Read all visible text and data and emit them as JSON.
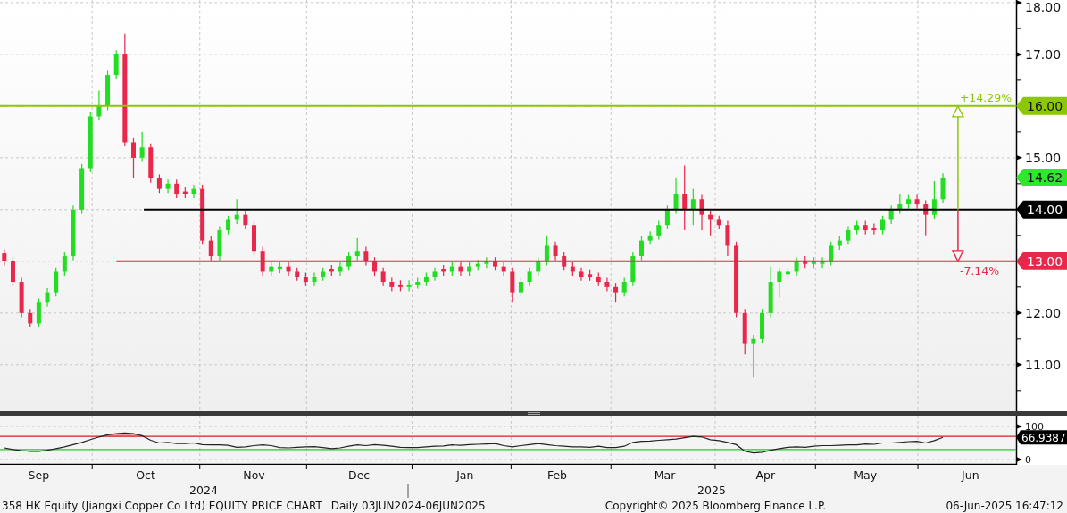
{
  "price_chart": {
    "chart_data": {
      "type": "candlestick",
      "categories": [
        null,
        null,
        null,
        null,
        null,
        null,
        null,
        null,
        null,
        null,
        null,
        null,
        null,
        null,
        null,
        null,
        null,
        null,
        null,
        null,
        null,
        null,
        null,
        null,
        null,
        null,
        null,
        null,
        null,
        null,
        null,
        null,
        null,
        null,
        null,
        null,
        null,
        null,
        null,
        null,
        null,
        null,
        null,
        null,
        null,
        null,
        null,
        null,
        null,
        null,
        null,
        null,
        null,
        null,
        null,
        null,
        null,
        null,
        null,
        null,
        null,
        null,
        null,
        null,
        null,
        null,
        null,
        null,
        null,
        null,
        null,
        null,
        null,
        null,
        null,
        null,
        null,
        null,
        null,
        null,
        null,
        null,
        null,
        null,
        null,
        null,
        null,
        null,
        null,
        null,
        null,
        null,
        null,
        null,
        null,
        null,
        null,
        null,
        null,
        null,
        null,
        null,
        null,
        null,
        null,
        null,
        null,
        null,
        null,
        null,
        null,
        null,
        null,
        null,
        null,
        null,
        null,
        null
      ],
      "ohlc": [
        [
          13.15,
          13.23,
          12.92,
          13.0
        ],
        [
          13.0,
          13.08,
          12.52,
          12.6
        ],
        [
          12.6,
          12.68,
          11.92,
          12.0
        ],
        [
          12.0,
          12.08,
          11.72,
          11.8
        ],
        [
          11.8,
          12.28,
          11.72,
          12.2
        ],
        [
          12.2,
          12.48,
          12.12,
          12.4
        ],
        [
          12.4,
          12.88,
          12.32,
          12.8
        ],
        [
          12.8,
          13.18,
          12.72,
          13.1
        ],
        [
          13.1,
          14.08,
          13.02,
          14.0
        ],
        [
          14.0,
          14.88,
          13.92,
          14.8
        ],
        [
          14.8,
          15.88,
          14.72,
          15.8
        ],
        [
          15.8,
          16.3,
          15.72,
          16.0
        ],
        [
          16.0,
          16.68,
          15.92,
          16.6
        ],
        [
          16.6,
          17.08,
          16.52,
          17.0
        ],
        [
          17.0,
          17.4,
          15.22,
          15.3
        ],
        [
          15.3,
          15.38,
          14.6,
          15.0
        ],
        [
          15.0,
          15.5,
          14.92,
          15.2
        ],
        [
          15.2,
          15.28,
          14.52,
          14.6
        ],
        [
          14.6,
          14.68,
          14.32,
          14.4
        ],
        [
          14.4,
          14.58,
          14.32,
          14.5
        ],
        [
          14.5,
          14.58,
          14.22,
          14.3
        ],
        [
          14.35,
          14.43,
          14.22,
          14.3
        ],
        [
          14.3,
          14.48,
          14.22,
          14.4
        ],
        [
          14.4,
          14.48,
          13.32,
          13.4
        ],
        [
          13.4,
          13.48,
          13.02,
          13.1
        ],
        [
          13.1,
          13.68,
          13.02,
          13.6
        ],
        [
          13.6,
          13.88,
          13.52,
          13.8
        ],
        [
          13.8,
          14.2,
          13.72,
          13.9
        ],
        [
          13.9,
          13.98,
          13.62,
          13.7
        ],
        [
          13.7,
          13.78,
          13.12,
          13.2
        ],
        [
          13.2,
          13.28,
          12.72,
          12.8
        ],
        [
          12.8,
          12.98,
          12.72,
          12.9
        ],
        [
          12.85,
          12.98,
          12.77,
          12.9
        ],
        [
          12.9,
          12.98,
          12.72,
          12.8
        ],
        [
          12.8,
          12.88,
          12.62,
          12.7
        ],
        [
          12.7,
          12.78,
          12.52,
          12.6
        ],
        [
          12.6,
          12.78,
          12.52,
          12.7
        ],
        [
          12.7,
          12.88,
          12.62,
          12.8
        ],
        [
          12.85,
          12.93,
          12.72,
          12.8
        ],
        [
          12.8,
          12.98,
          12.72,
          12.9
        ],
        [
          12.9,
          13.18,
          12.82,
          13.1
        ],
        [
          13.1,
          13.45,
          13.02,
          13.2
        ],
        [
          13.2,
          13.28,
          12.92,
          13.0
        ],
        [
          13.0,
          13.08,
          12.72,
          12.8
        ],
        [
          12.8,
          12.88,
          12.52,
          12.6
        ],
        [
          12.6,
          12.68,
          12.42,
          12.5
        ],
        [
          12.55,
          12.63,
          12.42,
          12.5
        ],
        [
          12.5,
          12.63,
          12.42,
          12.55
        ],
        [
          12.55,
          12.68,
          12.47,
          12.6
        ],
        [
          12.6,
          12.78,
          12.52,
          12.7
        ],
        [
          12.7,
          12.88,
          12.62,
          12.8
        ],
        [
          12.85,
          12.93,
          12.72,
          12.8
        ],
        [
          12.8,
          12.98,
          12.72,
          12.9
        ],
        [
          12.9,
          12.98,
          12.72,
          12.8
        ],
        [
          12.8,
          12.98,
          12.72,
          12.9
        ],
        [
          12.9,
          13.03,
          12.82,
          12.95
        ],
        [
          12.95,
          13.08,
          12.87,
          13.0
        ],
        [
          13.0,
          13.08,
          12.82,
          12.9
        ],
        [
          12.9,
          12.98,
          12.72,
          12.8
        ],
        [
          12.8,
          12.88,
          12.2,
          12.4
        ],
        [
          12.4,
          12.68,
          12.32,
          12.6
        ],
        [
          12.6,
          12.88,
          12.52,
          12.8
        ],
        [
          12.8,
          13.08,
          12.72,
          13.0
        ],
        [
          13.0,
          13.5,
          12.92,
          13.3
        ],
        [
          13.3,
          13.38,
          13.02,
          13.1
        ],
        [
          13.1,
          13.18,
          12.82,
          12.9
        ],
        [
          12.9,
          12.98,
          12.72,
          12.8
        ],
        [
          12.8,
          12.88,
          12.62,
          12.7
        ],
        [
          12.75,
          12.83,
          12.62,
          12.7
        ],
        [
          12.7,
          12.78,
          12.52,
          12.6
        ],
        [
          12.6,
          12.68,
          12.42,
          12.5
        ],
        [
          12.5,
          12.58,
          12.2,
          12.4
        ],
        [
          12.4,
          12.68,
          12.32,
          12.6
        ],
        [
          12.6,
          13.18,
          12.52,
          13.1
        ],
        [
          13.1,
          13.48,
          13.02,
          13.4
        ],
        [
          13.4,
          13.58,
          13.32,
          13.5
        ],
        [
          13.5,
          13.78,
          13.42,
          13.7
        ],
        [
          13.7,
          14.08,
          13.62,
          14.0
        ],
        [
          14.0,
          14.6,
          13.92,
          14.3
        ],
        [
          14.3,
          14.85,
          13.6,
          14.0
        ],
        [
          14.0,
          14.4,
          13.7,
          14.2
        ],
        [
          14.2,
          14.28,
          13.6,
          13.9
        ],
        [
          13.9,
          13.98,
          13.5,
          13.8
        ],
        [
          13.8,
          13.88,
          13.62,
          13.7
        ],
        [
          13.7,
          13.78,
          13.1,
          13.3
        ],
        [
          13.3,
          13.38,
          11.92,
          12.0
        ],
        [
          12.0,
          12.08,
          11.2,
          11.4
        ],
        [
          11.4,
          11.58,
          10.75,
          11.5
        ],
        [
          11.5,
          12.08,
          11.42,
          12.0
        ],
        [
          12.0,
          12.9,
          11.92,
          12.6
        ],
        [
          12.6,
          12.88,
          12.3,
          12.8
        ],
        [
          12.75,
          12.88,
          12.67,
          12.8
        ],
        [
          12.8,
          13.08,
          12.72,
          13.0
        ],
        [
          13.0,
          13.1,
          12.87,
          12.95
        ],
        [
          12.95,
          13.08,
          12.87,
          13.0
        ],
        [
          12.95,
          13.08,
          12.87,
          13.0
        ],
        [
          13.0,
          13.38,
          12.92,
          13.3
        ],
        [
          13.3,
          13.48,
          13.22,
          13.4
        ],
        [
          13.4,
          13.68,
          13.32,
          13.6
        ],
        [
          13.6,
          13.78,
          13.52,
          13.7
        ],
        [
          13.7,
          13.78,
          13.52,
          13.6
        ],
        [
          13.65,
          13.73,
          13.52,
          13.6
        ],
        [
          13.6,
          13.88,
          13.52,
          13.8
        ],
        [
          13.8,
          14.08,
          13.72,
          14.0
        ],
        [
          14.0,
          14.3,
          13.92,
          14.1
        ],
        [
          14.1,
          14.28,
          14.02,
          14.2
        ],
        [
          14.2,
          14.28,
          14.02,
          14.1
        ],
        [
          14.1,
          14.18,
          13.5,
          13.9
        ],
        [
          13.9,
          14.55,
          13.82,
          14.2
        ],
        [
          14.2,
          14.7,
          14.12,
          14.62
        ],
        null,
        null,
        null,
        null,
        null,
        null,
        null,
        null
      ],
      "ylim": [
        10.1,
        18.05
      ],
      "grid": true,
      "yticks": [
        {
          "value": 11,
          "label": "11.00"
        },
        {
          "value": 12,
          "label": "12.00"
        },
        {
          "value": 15,
          "label": "15.00"
        },
        {
          "value": 17,
          "label": "17.00"
        },
        {
          "value": 18,
          "label": "18.00"
        }
      ],
      "ref_lines": [
        {
          "axis": "y",
          "value": 16,
          "color": "#8cc800",
          "label": "16.00"
        },
        {
          "axis": "y",
          "value": 14,
          "color": "#000000",
          "label": "14.00"
        },
        {
          "axis": "y",
          "value": 13,
          "color": "#e8274b",
          "label": "13.00"
        }
      ],
      "annotations": [
        "14.62",
        "+14.29%",
        "-7.14%"
      ]
    }
  },
  "rsi_chart": {
    "chart_data": {
      "type": "line",
      "categories": [
        null,
        null,
        null,
        null,
        null,
        null,
        null,
        null,
        null,
        null,
        null,
        null,
        null,
        null,
        null,
        null,
        null,
        null,
        null,
        null,
        null,
        null,
        null,
        null,
        null,
        null,
        null,
        null,
        null,
        null,
        null,
        null,
        null,
        null,
        null,
        null,
        null,
        null,
        null,
        null,
        null,
        null,
        null,
        null,
        null,
        null,
        null,
        null,
        null,
        null,
        null,
        null,
        null,
        null,
        null,
        null,
        null,
        null,
        null,
        null,
        null,
        null,
        null,
        null,
        null,
        null,
        null,
        null,
        null,
        null,
        null,
        null,
        null,
        null,
        null,
        null,
        null,
        null,
        null,
        null,
        null,
        null,
        null,
        null,
        null,
        null,
        null,
        null,
        null,
        null,
        null,
        null,
        null,
        null,
        null,
        null,
        null,
        null,
        null,
        null,
        null,
        null,
        null,
        null,
        null,
        null,
        null,
        null,
        null,
        null,
        null,
        null,
        null,
        null,
        null,
        null,
        null,
        null
      ],
      "series": [
        {
          "values": [
            35,
            30,
            27,
            25,
            25,
            28,
            33,
            38,
            45,
            52,
            60,
            68,
            75,
            78,
            80,
            78,
            72,
            58,
            50,
            52,
            48,
            48,
            50,
            45,
            44,
            44,
            43,
            37,
            38,
            42,
            44,
            42,
            36,
            35,
            37,
            38,
            39,
            36,
            33,
            35,
            40,
            44,
            42,
            45,
            43,
            40,
            37,
            36,
            36,
            38,
            40,
            41,
            44,
            43,
            45,
            46,
            47,
            48,
            42,
            38,
            42,
            45,
            48,
            45,
            42,
            40,
            38,
            38,
            37,
            40,
            36,
            36,
            40,
            52,
            55,
            56,
            58,
            60,
            62,
            66,
            70,
            68,
            60,
            57,
            52,
            45,
            25,
            20,
            22,
            28,
            33,
            37,
            38,
            37,
            40,
            42,
            42,
            43,
            44,
            44,
            47,
            46,
            50,
            50,
            52,
            54,
            55,
            50,
            57,
            67,
            null,
            null,
            null,
            null,
            null,
            null,
            null,
            null
          ]
        }
      ],
      "ylim": [
        0,
        100
      ],
      "grid": true,
      "yticks": [
        {
          "value": 0,
          "label": "0"
        },
        {
          "value": 100,
          "label": "100"
        }
      ],
      "ref_lines": [
        {
          "axis": "y",
          "value": 70,
          "color": "#d42020"
        },
        {
          "axis": "y",
          "value": 30,
          "color": "#22cc22"
        }
      ],
      "annotations": [
        "66.9387"
      ]
    }
  },
  "month_labels": [
    "Sep",
    "Oct",
    "Nov",
    "Dec",
    "Jan",
    "Feb",
    "Mar",
    "Apr",
    "May",
    "Jun"
  ],
  "year_labels": [
    "2024",
    "2025"
  ],
  "footer": {
    "title": "358 HK Equity (Jiangxi Copper Co Ltd) EQUITY PRICE CHART",
    "range": "Daily 03JUN2024-06JUN2025",
    "copyright": "Copyright© 2025 Bloomberg Finance L.P.",
    "timestamp": "06-Jun-2025 16:47:12"
  }
}
